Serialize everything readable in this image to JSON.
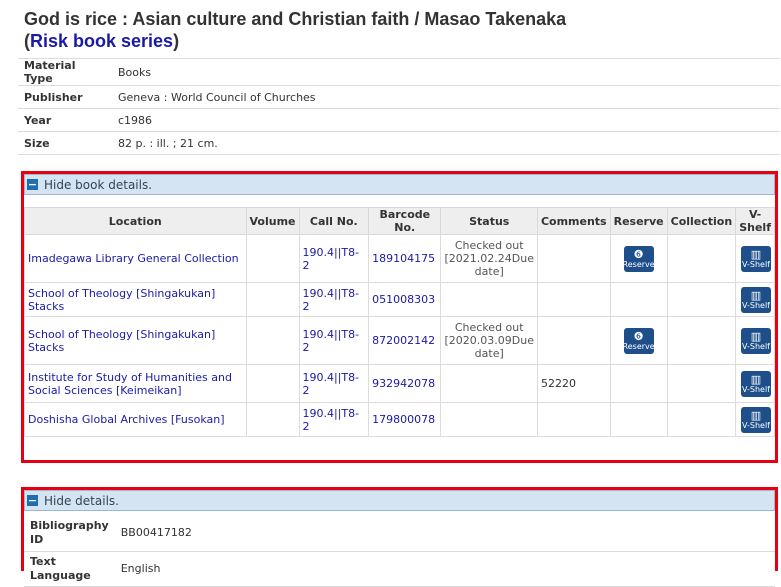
{
  "title": {
    "main": "God is rice : Asian culture and Christian faith / Masao Takenaka",
    "series_open": "(",
    "series_link": "Risk book series",
    "series_close": ")"
  },
  "metadata": [
    {
      "label": "Material Type",
      "value": "Books"
    },
    {
      "label": "Publisher",
      "value": "Geneva : World Council of Churches"
    },
    {
      "label": "Year",
      "value": "c1986"
    },
    {
      "label": "Size",
      "value": "82 p. : ill. ; 21 cm."
    }
  ],
  "book_details": {
    "toggle_label": "Hide book details.",
    "columns": [
      "Location",
      "Volume",
      "Call No.",
      "Barcode No.",
      "Status",
      "Comments",
      "Reserve",
      "Collection",
      "V-Shelf"
    ],
    "rows": [
      {
        "location": "Imadegawa Library General Collection",
        "volume": "",
        "call_no": "190.4||T8-2",
        "barcode": "189104175",
        "status": "Checked out [2021.02.24Due date]",
        "comments": "",
        "reserve": "Reserve",
        "collection": "",
        "vshelf": "V-Shelf"
      },
      {
        "location": "School of Theology [Shingakukan] Stacks",
        "volume": "",
        "call_no": "190.4||T8-2",
        "barcode": "051008303",
        "status": "",
        "comments": "",
        "reserve": "",
        "collection": "",
        "vshelf": "V-Shelf"
      },
      {
        "location": "School of Theology [Shingakukan] Stacks",
        "volume": "",
        "call_no": "190.4||T8-2",
        "barcode": "872002142",
        "status": "Checked out [2020.03.09Due date]",
        "comments": "",
        "reserve": "Reserve",
        "collection": "",
        "vshelf": "V-Shelf"
      },
      {
        "location": "Institute for Study of Humanities and Social Sciences [Keimeikan]",
        "volume": "",
        "call_no": "190.4||T8-2",
        "barcode": "932942078",
        "status": "",
        "comments": "52220",
        "reserve": "",
        "collection": "",
        "vshelf": "V-Shelf"
      },
      {
        "location": "Doshisha Global Archives [Fusokan]",
        "volume": "",
        "call_no": "190.4||T8-2",
        "barcode": "179800078",
        "status": "",
        "comments": "",
        "reserve": "",
        "collection": "",
        "vshelf": "V-Shelf"
      }
    ]
  },
  "details": {
    "toggle_label": "Hide details.",
    "rows": [
      {
        "label": "Bibliography ID",
        "value": "BB00417182"
      },
      {
        "label": "Text Language",
        "value": "English"
      }
    ]
  },
  "colors": {
    "highlight_border": "#e60012",
    "link": "#1a1aa6",
    "button": "#1e4f8a",
    "header_bg": "#d4e4f2"
  }
}
